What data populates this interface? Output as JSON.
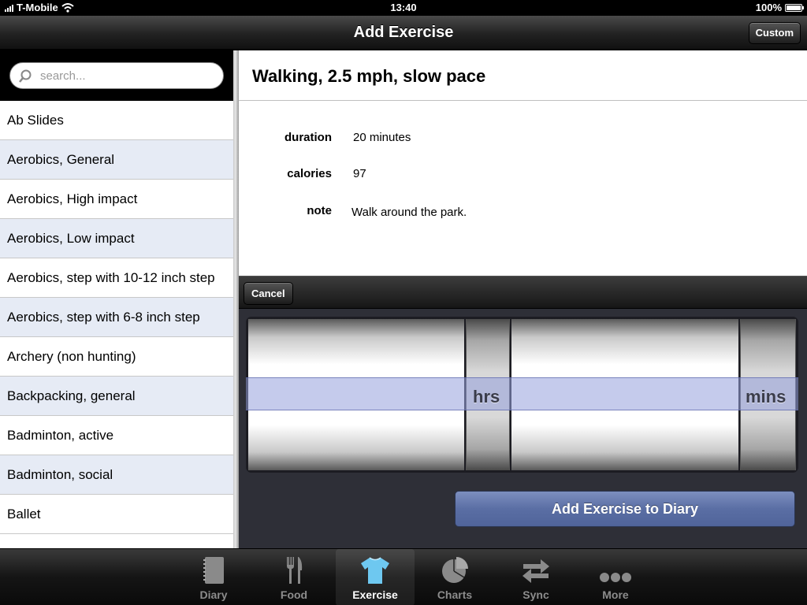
{
  "status_bar": {
    "carrier": "T-Mobile",
    "time": "13:40",
    "battery": "100%"
  },
  "nav": {
    "title": "Add Exercise",
    "custom_label": "Custom"
  },
  "search": {
    "placeholder": "search..."
  },
  "exercise_list": [
    "Ab Slides",
    "Aerobics, General",
    "Aerobics, High impact",
    "Aerobics, Low impact",
    "Aerobics, step with 10-12 inch step",
    "Aerobics, step with 6-8 inch step",
    "Archery (non hunting)",
    "Backpacking, general",
    "Badminton, active",
    "Badminton, social",
    "Ballet"
  ],
  "detail": {
    "title": "Walking, 2.5 mph, slow pace",
    "fields": [
      {
        "label": "duration",
        "value": "20 minutes"
      },
      {
        "label": "calories",
        "value": "97"
      },
      {
        "label": "note",
        "value": "Walk around the park."
      }
    ]
  },
  "picker": {
    "cancel_label": "Cancel",
    "hours_unit": "hrs",
    "minutes_unit": "mins",
    "add_label": "Add Exercise to Diary"
  },
  "tabs": [
    {
      "label": "Diary",
      "icon": "notebook-icon",
      "active": false
    },
    {
      "label": "Food",
      "icon": "fork-knife-icon",
      "active": false
    },
    {
      "label": "Exercise",
      "icon": "tshirt-icon",
      "active": true
    },
    {
      "label": "Charts",
      "icon": "pie-chart-icon",
      "active": false
    },
    {
      "label": "Sync",
      "icon": "sync-arrows-icon",
      "active": false
    },
    {
      "label": "More",
      "icon": "more-dots-icon",
      "active": false
    }
  ],
  "colors": {
    "active_tab_icon": "#6ec8f0",
    "list_alt_row": "#e6ebf5",
    "add_button": "#5a6ea4"
  }
}
